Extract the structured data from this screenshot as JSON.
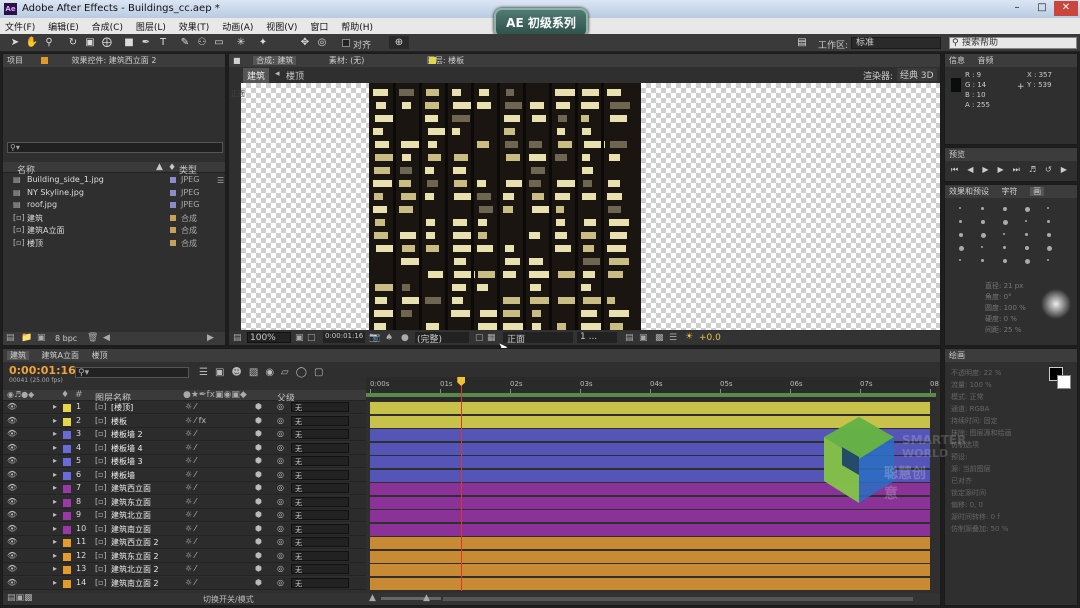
{
  "window": {
    "title": "Adobe After Effects - Buildings_cc.aep *",
    "app_icon": "Ae"
  },
  "badge": "AE 初级系列",
  "menu": [
    "文件(F)",
    "编辑(E)",
    "合成(C)",
    "图层(L)",
    "效果(T)",
    "动画(A)",
    "视图(V)",
    "窗口",
    "帮助(H)"
  ],
  "toolbar": {
    "snap_label": "对齐",
    "workspace_label": "工作区:",
    "workspace_value": "标准",
    "search_placeholder": "搜索帮助"
  },
  "project_panel": {
    "tabs": [
      "项目",
      "效果控件: 建筑西立面 2"
    ],
    "col_name": "名称",
    "col_type": "类型",
    "items": [
      {
        "name": "Building_side_1.jpg",
        "type": "JPEG",
        "kind": "file",
        "color": "#8c8cc8"
      },
      {
        "name": "NY Skyline.jpg",
        "type": "JPEG",
        "kind": "file",
        "color": "#8c8cc8"
      },
      {
        "name": "roof.jpg",
        "type": "JPEG",
        "kind": "file",
        "color": "#8c8cc8"
      },
      {
        "name": "建筑",
        "type": "合成",
        "kind": "comp",
        "color": "#c8a05a"
      },
      {
        "name": "建筑A立面",
        "type": "合成",
        "kind": "comp",
        "color": "#c8a05a"
      },
      {
        "name": "楼顶",
        "type": "合成",
        "kind": "comp",
        "color": "#c8a05a"
      }
    ],
    "bpc": "8 bpc"
  },
  "comp_panel": {
    "tabs": [
      "合成: 建筑",
      "素材: (无)",
      "图层: 楼板"
    ],
    "subtabs": [
      "建筑",
      "楼顶"
    ],
    "renderer": "渲染器:",
    "renderer_value": "经典 3D",
    "view_label": "正面",
    "zoom": "100%",
    "timecode": "0:00:01:16",
    "quality": "(完整)",
    "views": "1 ...",
    "exposure": "+0.0",
    "corner_label": "正面"
  },
  "info_panel": {
    "tabs": [
      "信息",
      "音频"
    ],
    "r": "R : 9",
    "g": "G : 14",
    "b": "B : 10",
    "a": "A : 255",
    "x": "X : 357",
    "y": "Y : 539"
  },
  "preview_panel": {
    "title": "预览"
  },
  "effects_panel": {
    "tabs": [
      "效果和预设",
      "字符",
      "画"
    ],
    "labels": [
      "直径: 21 px",
      "角度: 0°",
      "圆度: 100 %",
      "硬度: 0 %",
      "间距: 25 %"
    ]
  },
  "paint_panel": {
    "title": "绘画",
    "opacity": "不透明度: 22 %",
    "flow": "流量: 100 %",
    "mode": "模式: 正常",
    "channels": "通道: RGBA",
    "duration": "持续时间: 固定",
    "erase": "抹除: 图层源和绘画",
    "clone": "仿制选项",
    "preset": "预设:",
    "source": "源: 当前图层",
    "aligned": "已对齐",
    "lock": "锁定源时间",
    "offset": "偏移: 0, 0",
    "time_shift": "源时间转移: 0 f",
    "clone_overlay": "仿制源叠加: 50 %"
  },
  "timeline": {
    "tabs": [
      "建筑",
      "建筑A立面",
      "楼顶"
    ],
    "timecode": "0:00:01:16",
    "frames": "00041 (25.00 fps)",
    "col_layer": "图层名称",
    "col_parent": "父级",
    "ruler": [
      "0:00s",
      "01s",
      "02s",
      "03s",
      "04s",
      "05s",
      "06s",
      "07s",
      "08"
    ],
    "playhead_frac": 0.163,
    "layers": [
      {
        "num": "1",
        "name": "[楼顶]",
        "color": "#e2d64b",
        "bar": "#c9c24a",
        "fx": false,
        "parent": "无"
      },
      {
        "num": "2",
        "name": "楼板",
        "color": "#e2d64b",
        "bar": "#c9c24a",
        "fx": true,
        "parent": "无"
      },
      {
        "num": "3",
        "name": "楼板墙 2",
        "color": "#6a6ad8",
        "bar": "#5555b8",
        "fx": false,
        "parent": "无"
      },
      {
        "num": "4",
        "name": "楼板墙 4",
        "color": "#6a6ad8",
        "bar": "#5555b8",
        "fx": false,
        "parent": "无"
      },
      {
        "num": "5",
        "name": "楼板墙 3",
        "color": "#6a6ad8",
        "bar": "#5555b8",
        "fx": false,
        "parent": "无"
      },
      {
        "num": "6",
        "name": "楼板墙",
        "color": "#6a6ad8",
        "bar": "#5555b8",
        "fx": false,
        "parent": "无"
      },
      {
        "num": "7",
        "name": "建筑西立面",
        "color": "#9a38a8",
        "bar": "#8a3298",
        "fx": false,
        "parent": "无"
      },
      {
        "num": "8",
        "name": "建筑东立面",
        "color": "#9a38a8",
        "bar": "#8a3298",
        "fx": false,
        "parent": "无"
      },
      {
        "num": "9",
        "name": "建筑北立面",
        "color": "#9a38a8",
        "bar": "#8a3298",
        "fx": false,
        "parent": "无"
      },
      {
        "num": "10",
        "name": "建筑南立面",
        "color": "#9a38a8",
        "bar": "#8a3298",
        "fx": false,
        "parent": "无"
      },
      {
        "num": "11",
        "name": "建筑西立面 2",
        "color": "#e59a2c",
        "bar": "#c88a32",
        "fx": false,
        "parent": "无"
      },
      {
        "num": "12",
        "name": "建筑东立面 2",
        "color": "#e59a2c",
        "bar": "#c88a32",
        "fx": false,
        "parent": "无"
      },
      {
        "num": "13",
        "name": "建筑北立面 2",
        "color": "#e59a2c",
        "bar": "#c88a32",
        "fx": false,
        "parent": "无"
      },
      {
        "num": "14",
        "name": "建筑南立面 2",
        "color": "#e59a2c",
        "bar": "#c88a32",
        "fx": false,
        "parent": "无"
      }
    ],
    "toggle_label": "切换开关/模式"
  },
  "watermark": {
    "line1": "SMARTER",
    "line2": "WORLD",
    "line3": "聪慧创意"
  }
}
